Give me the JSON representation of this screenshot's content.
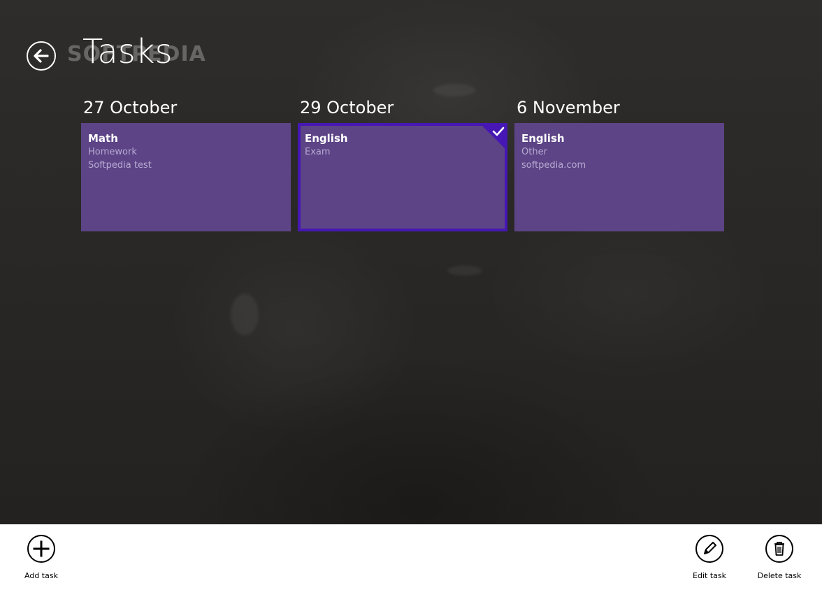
{
  "app": {
    "title": "Tasks",
    "watermark": "SOFTPEDIA"
  },
  "colors": {
    "tile": "#5d4486",
    "tile_selected_border": "#4617b4",
    "tile_secondary_text": "#b7a9d1",
    "background": "#2a2826",
    "app_bar": "#ffffff"
  },
  "groups": [
    {
      "date": "27 October",
      "task": {
        "subject": "Math",
        "type": "Homework",
        "note": "Softpedia test",
        "selected": false
      }
    },
    {
      "date": "29 October",
      "task": {
        "subject": "English",
        "type": "Exam",
        "note": "",
        "selected": true
      }
    },
    {
      "date": "6 November",
      "task": {
        "subject": "English",
        "type": "Other",
        "note": "softpedia.com",
        "selected": false
      }
    }
  ],
  "app_bar": {
    "add_label": "Add task",
    "add_icon": "plus-icon",
    "edit_label": "Edit task",
    "edit_icon": "pencil-icon",
    "delete_label": "Delete task",
    "delete_icon": "trash-icon"
  },
  "icons": {
    "back": "back-arrow-icon",
    "selected": "checkmark-icon"
  }
}
